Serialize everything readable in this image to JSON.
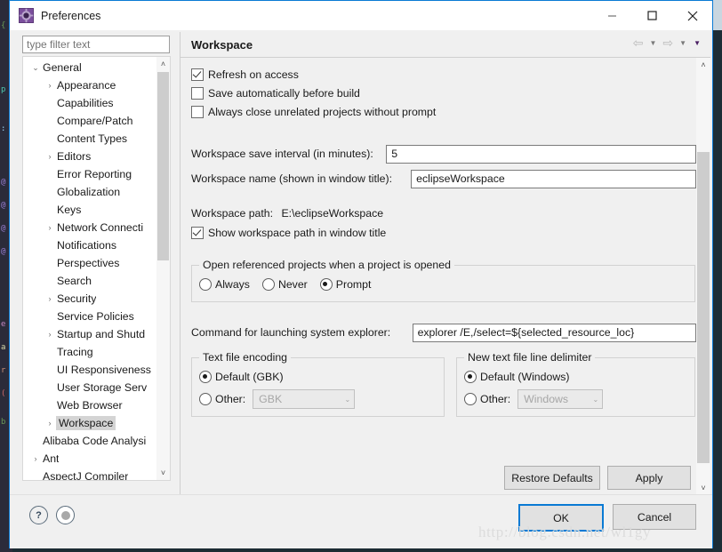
{
  "window": {
    "title": "Preferences",
    "icon": "preferences-gear-icon",
    "minimize_label": "—",
    "maximize_label": "☐",
    "close_label": "✕"
  },
  "filter": {
    "placeholder": "type filter text",
    "value": ""
  },
  "tree": {
    "items": [
      {
        "label": "General",
        "depth": 0,
        "arrow": "⌄",
        "expanded": true,
        "selected": false
      },
      {
        "label": "Appearance",
        "depth": 1,
        "arrow": "›",
        "expanded": false,
        "selected": false
      },
      {
        "label": "Capabilities",
        "depth": 1,
        "arrow": "",
        "expanded": false,
        "selected": false
      },
      {
        "label": "Compare/Patch",
        "depth": 1,
        "arrow": "",
        "expanded": false,
        "selected": false
      },
      {
        "label": "Content Types",
        "depth": 1,
        "arrow": "",
        "expanded": false,
        "selected": false
      },
      {
        "label": "Editors",
        "depth": 1,
        "arrow": "›",
        "expanded": false,
        "selected": false
      },
      {
        "label": "Error Reporting",
        "depth": 1,
        "arrow": "",
        "expanded": false,
        "selected": false
      },
      {
        "label": "Globalization",
        "depth": 1,
        "arrow": "",
        "expanded": false,
        "selected": false
      },
      {
        "label": "Keys",
        "depth": 1,
        "arrow": "",
        "expanded": false,
        "selected": false
      },
      {
        "label": "Network Connecti",
        "depth": 1,
        "arrow": "›",
        "expanded": false,
        "selected": false
      },
      {
        "label": "Notifications",
        "depth": 1,
        "arrow": "",
        "expanded": false,
        "selected": false
      },
      {
        "label": "Perspectives",
        "depth": 1,
        "arrow": "",
        "expanded": false,
        "selected": false
      },
      {
        "label": "Search",
        "depth": 1,
        "arrow": "",
        "expanded": false,
        "selected": false
      },
      {
        "label": "Security",
        "depth": 1,
        "arrow": "›",
        "expanded": false,
        "selected": false
      },
      {
        "label": "Service Policies",
        "depth": 1,
        "arrow": "",
        "expanded": false,
        "selected": false
      },
      {
        "label": "Startup and Shutd",
        "depth": 1,
        "arrow": "›",
        "expanded": false,
        "selected": false
      },
      {
        "label": "Tracing",
        "depth": 1,
        "arrow": "",
        "expanded": false,
        "selected": false
      },
      {
        "label": "UI Responsiveness",
        "depth": 1,
        "arrow": "",
        "expanded": false,
        "selected": false
      },
      {
        "label": "User Storage Serv",
        "depth": 1,
        "arrow": "",
        "expanded": false,
        "selected": false
      },
      {
        "label": "Web Browser",
        "depth": 1,
        "arrow": "",
        "expanded": false,
        "selected": false
      },
      {
        "label": "Workspace",
        "depth": 1,
        "arrow": "›",
        "expanded": false,
        "selected": true
      },
      {
        "label": "Alibaba Code Analysi",
        "depth": 0,
        "arrow": "",
        "expanded": false,
        "selected": false
      },
      {
        "label": "Ant",
        "depth": 0,
        "arrow": "›",
        "expanded": false,
        "selected": false
      },
      {
        "label": "AspectJ Compiler",
        "depth": 0,
        "arrow": "",
        "expanded": false,
        "selected": false
      }
    ],
    "scroll_up_icon": "˄",
    "scroll_down_icon": "˅",
    "scroll_left_icon": "‹",
    "scroll_right_icon": "›"
  },
  "page": {
    "title": "Workspace",
    "nav": {
      "back_icon": "⇦",
      "back_caret": "▼",
      "forward_icon": "⇨",
      "forward_caret": "▼",
      "menu_caret": "▼"
    },
    "checkboxes": [
      {
        "label": "Refresh on access",
        "checked": true
      },
      {
        "label": "Save automatically before build",
        "checked": false
      },
      {
        "label": "Always close unrelated projects without prompt",
        "checked": false
      }
    ],
    "save_interval": {
      "label": "Workspace save interval (in minutes):",
      "value": "5"
    },
    "workspace_name": {
      "label": "Workspace name (shown in window title):",
      "value": "eclipseWorkspace"
    },
    "workspace_path": {
      "label": "Workspace path:",
      "value": "E:\\eclipseWorkspace"
    },
    "show_path_checkbox": {
      "label": "Show workspace path in window title",
      "checked": true
    },
    "open_referenced": {
      "title": "Open referenced projects when a project is opened",
      "options": [
        {
          "label": "Always",
          "selected": false
        },
        {
          "label": "Never",
          "selected": false
        },
        {
          "label": "Prompt",
          "selected": true
        }
      ]
    },
    "explorer_command": {
      "label": "Command for launching system explorer:",
      "value": "explorer /E,/select=${selected_resource_loc}"
    },
    "text_file_encoding": {
      "title": "Text file encoding",
      "default_option": {
        "label": "Default (GBK)",
        "selected": true
      },
      "other_option": {
        "label": "Other:",
        "selected": false
      },
      "combo_value": "GBK",
      "combo_caret": "⌄",
      "disabled": true
    },
    "line_delimiter": {
      "title": "New text file line delimiter",
      "default_option": {
        "label": "Default (Windows)",
        "selected": true
      },
      "other_option": {
        "label": "Other:",
        "selected": false
      },
      "combo_value": "Windows",
      "combo_caret": "⌄",
      "disabled": true
    },
    "restore_defaults_label": "Restore Defaults",
    "apply_label": "Apply",
    "scroll_up_icon": "˄",
    "scroll_down_icon": "˅"
  },
  "footer": {
    "help_icon": "?",
    "info_icon": "info-circle-icon",
    "ok_label": "OK",
    "cancel_label": "Cancel"
  },
  "watermark": "http://blog.csdn.net/wl1gy",
  "colors": {
    "accent": "#0a7ad4",
    "dialog_bg": "#f0f0f0",
    "selection": "#d4d4d4"
  }
}
